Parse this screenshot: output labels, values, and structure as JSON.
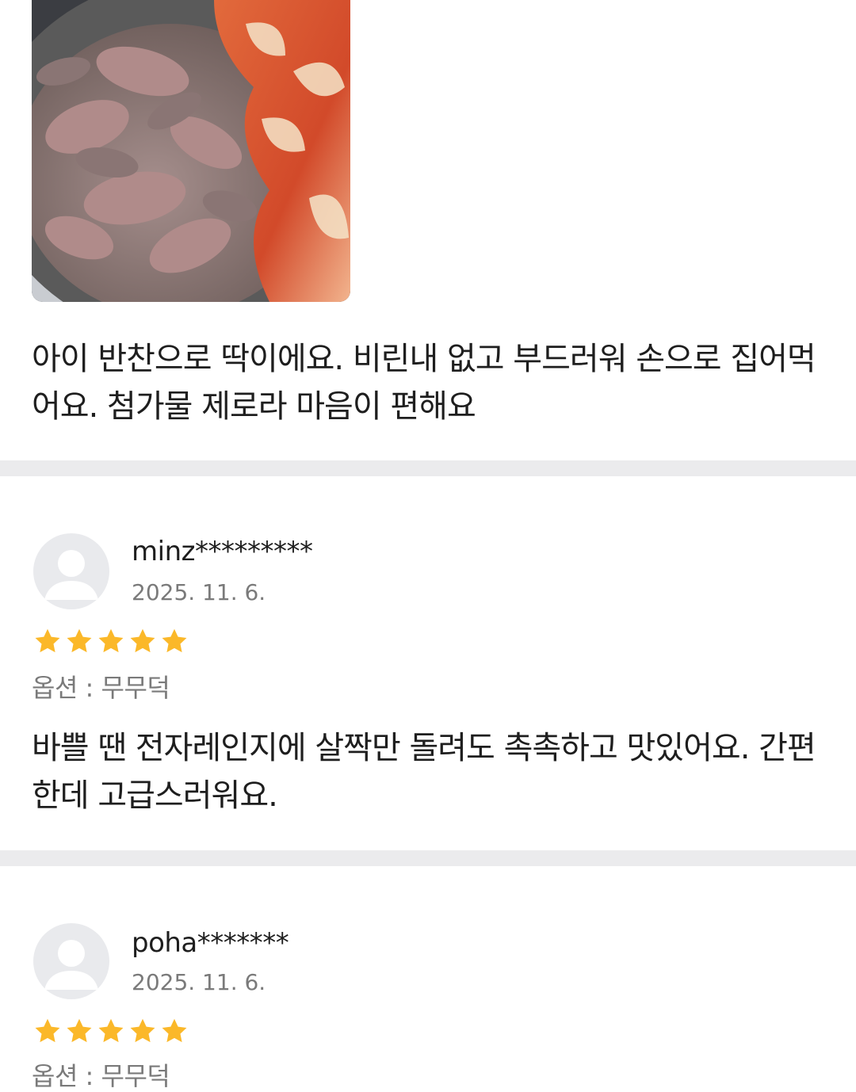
{
  "reviews": [
    {
      "text": "아이 반찬으로 딱이에요. 비린내 없고 부드러워 손으로 집어먹어요. 첨가물 제로라 마음이 편해요",
      "has_photo": true
    },
    {
      "username": "minz*********",
      "date": "2025. 11. 6.",
      "rating": 5,
      "option": "옵션 : 무무덕",
      "text": "바쁠 땐 전자레인지에 살짝만 돌려도 촉촉하고 맛있어요. 간편한데 고급스러워요."
    },
    {
      "username": "poha*******",
      "date": "2025. 11. 6.",
      "rating": 5,
      "option": "옵션 : 무무덕"
    }
  ],
  "colors": {
    "star": "#fbb829",
    "divider": "#ebebed",
    "avatar_bg": "#e9eaed",
    "avatar_fg": "#ffffff",
    "secondary_text": "#7a7a7a"
  },
  "icons": {
    "avatar": "default-user-avatar-icon",
    "star": "star-icon"
  }
}
